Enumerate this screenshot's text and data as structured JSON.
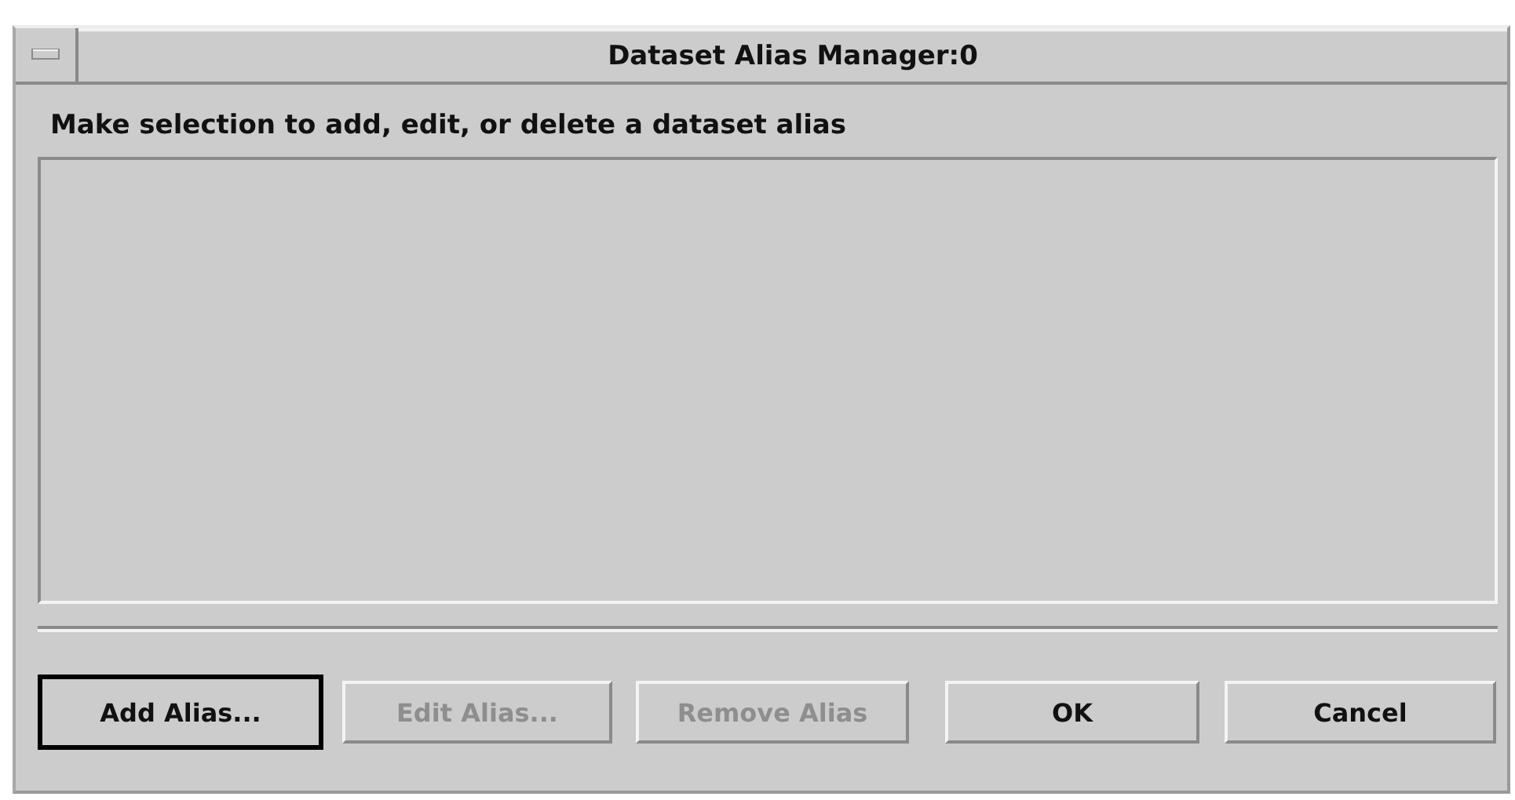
{
  "window": {
    "title": "Dataset Alias Manager:0"
  },
  "prompt": "Make selection to add, edit, or delete a dataset alias",
  "buttons": [
    {
      "label": "Add Alias...",
      "default": true,
      "disabled": false
    },
    {
      "label": "Edit Alias...",
      "default": false,
      "disabled": true
    },
    {
      "label": "Remove Alias",
      "default": false,
      "disabled": true
    },
    {
      "label": "OK",
      "default": false,
      "disabled": false
    },
    {
      "label": "Cancel",
      "default": false,
      "disabled": false
    }
  ]
}
